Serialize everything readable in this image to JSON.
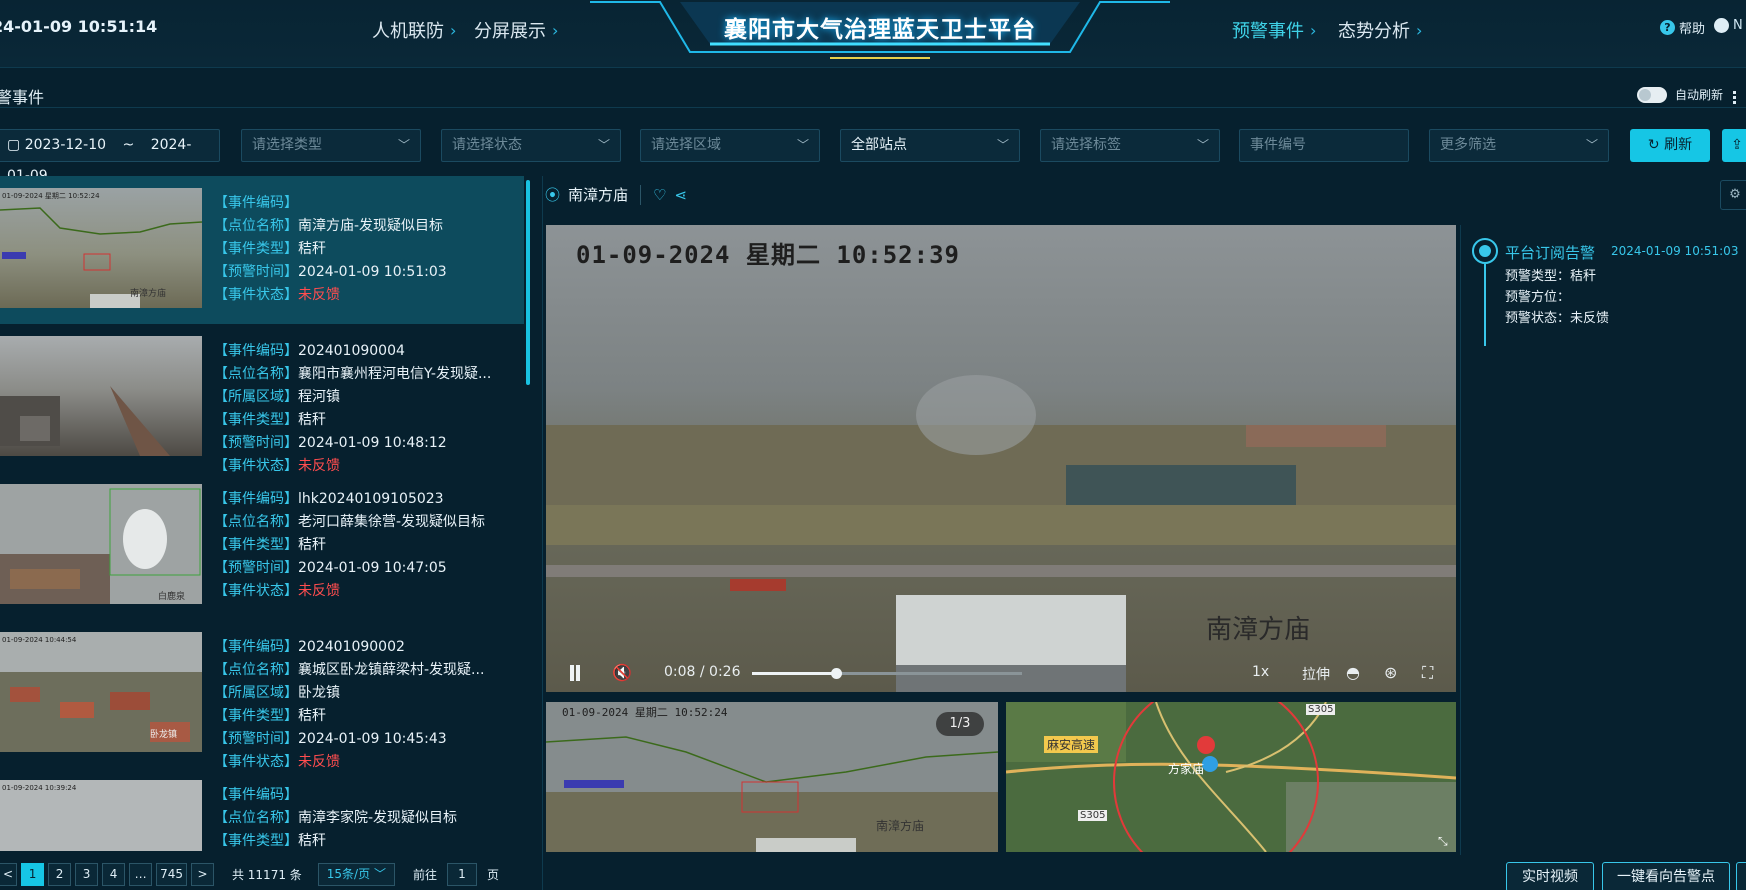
{
  "header": {
    "clock": "24-01-09 10:51:14",
    "nav_left": [
      "人机联防",
      "分屏展示"
    ],
    "title": "襄阳市大气治理蓝天卫士平台",
    "nav_right": [
      "预警事件",
      "态势分析"
    ],
    "help": "帮助",
    "user": "N"
  },
  "subheader": {
    "title": "警事件",
    "auto_refresh": "自动刷新"
  },
  "filters": {
    "date_start": "2023-12-10",
    "date_sep": "~",
    "date_end": "2024-01-09",
    "type_placeholder": "请选择类型",
    "status_placeholder": "请选择状态",
    "area_placeholder": "请选择区域",
    "station_value": "全部站点",
    "tag_placeholder": "请选择标签",
    "event_no_placeholder": "事件编号",
    "more_placeholder": "更多筛选",
    "refresh": "刷新"
  },
  "events": [
    {
      "labels": [
        "【事件编码】",
        "【点位名称】",
        "【事件类型】",
        "【预警时间】",
        "【事件状态】"
      ],
      "values": [
        "",
        "南漳方庙-发现疑似目标",
        "秸秆",
        "2024-01-09 10:51:03",
        "未反馈"
      ],
      "thumb_ts": "01-09-2024 星期二 10:52:24",
      "thumb_wm": "南漳方庙"
    },
    {
      "labels": [
        "【事件编码】",
        "【点位名称】",
        "【所属区域】",
        "【事件类型】",
        "【预警时间】",
        "【事件状态】"
      ],
      "values": [
        "202401090004",
        "襄阳市襄州程河电信Y-发现疑...",
        "程河镇",
        "秸秆",
        "2024-01-09 10:48:12",
        "未反馈"
      ],
      "thumb_ts": "",
      "thumb_wm": ""
    },
    {
      "labels": [
        "【事件编码】",
        "【点位名称】",
        "【事件类型】",
        "【预警时间】",
        "【事件状态】"
      ],
      "values": [
        "lhk20240109105023",
        "老河口薛集徐营-发现疑似目标",
        "秸秆",
        "2024-01-09 10:47:05",
        "未反馈"
      ],
      "thumb_ts": "",
      "thumb_wm": "白鹿泉"
    },
    {
      "labels": [
        "【事件编码】",
        "【点位名称】",
        "【所属区域】",
        "【事件类型】",
        "【预警时间】",
        "【事件状态】"
      ],
      "values": [
        "202401090002",
        "襄城区卧龙镇薛梁村-发现疑...",
        "卧龙镇",
        "秸秆",
        "2024-01-09 10:45:43",
        "未反馈"
      ],
      "thumb_ts": "01-09-2024 10:44:54",
      "thumb_wm": "卧龙镇"
    },
    {
      "labels": [
        "【事件编码】",
        "【点位名称】",
        "【事件类型】"
      ],
      "values": [
        "",
        "南漳李家院-发现疑似目标",
        "秸秆"
      ],
      "thumb_ts": "01-09-2024 10:39:24",
      "thumb_wm": ""
    }
  ],
  "pager": {
    "prev": "<",
    "pages": [
      "1",
      "2",
      "3",
      "4",
      "…",
      "745"
    ],
    "next": ">",
    "total": "共 11171 条",
    "per_page": "15条/页",
    "goto": "前往",
    "goto_value": "1",
    "page_unit": "页"
  },
  "player": {
    "location": "南漳方庙",
    "osd": "01-09-2024 星期二 10:52:39",
    "watermark": "南漳方庙",
    "time": "0:08 / 0:26",
    "progress": 0.31,
    "rate": "1x",
    "stretch": "拉伸",
    "sub_osd": "01-09-2024 星期二 10:52:24",
    "sub_wm": "南漳方庙",
    "image_counter": "1/3"
  },
  "map": {
    "road": "麻安高速",
    "place": "方家庙",
    "road2": "S305",
    "road3": "S305"
  },
  "alarm": {
    "title": "平台订阅告警",
    "time": "2024-01-09 10:51:03",
    "type": "预警类型：秸秆",
    "direction": "预警方位：",
    "status": "预警状态：未反馈"
  },
  "actions": {
    "realtime_video": "实时视频",
    "look_at_point": "一键看向告警点"
  },
  "colors": {
    "accent": "#16c6e5",
    "alert": "#ff4d4f",
    "bg": "#06202e"
  }
}
